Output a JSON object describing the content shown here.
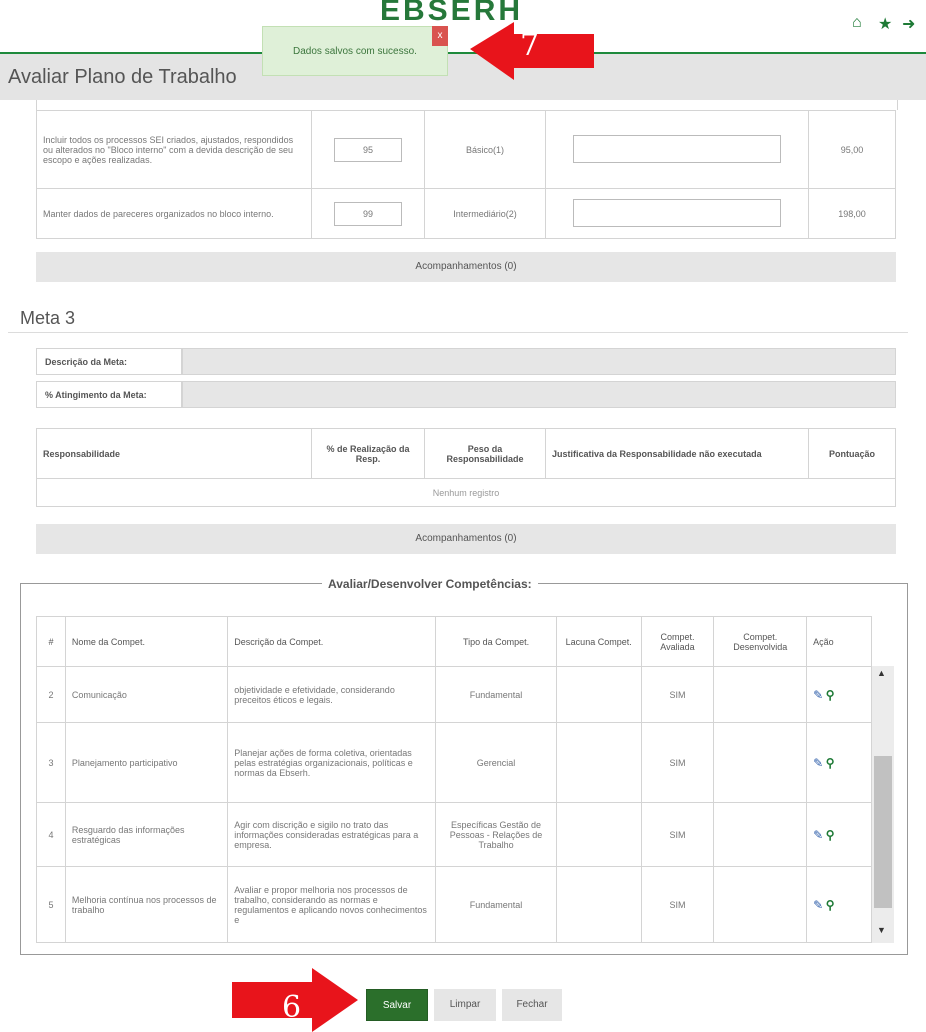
{
  "header": {
    "logo_text": "EBSERH"
  },
  "toast": {
    "message": "Dados salvos com sucesso.",
    "close": "x"
  },
  "title": "Avaliar Plano de Trabalho",
  "steps": {
    "toast_step": "7",
    "save_step": "6"
  },
  "upper_table": {
    "rows": [
      {
        "desc": "Incluir todos os processos SEI criados, ajustados, respondidos ou alterados no \"Bloco interno\" com a devida descrição de seu escopo e ações realizadas.",
        "value": "95",
        "peso": "Básico(1)",
        "pont": "95,00"
      },
      {
        "desc": "Manter dados de pareceres organizados no bloco interno.",
        "value": "99",
        "peso": "Intermediário(2)",
        "pont": "198,00"
      }
    ]
  },
  "acompanhamentos": "Acompanhamentos (0)",
  "meta3": {
    "title": "Meta 3",
    "desc_label": "Descrição da Meta:",
    "ating_label": "% Atingimento da Meta:",
    "headers": [
      "Responsabilidade",
      "% de Realização da Resp.",
      "Peso da Responsabilidade",
      "Justificativa da Responsabilidade não executada",
      "Pontuação"
    ],
    "empty": "Nenhum registro"
  },
  "competencias": {
    "legend": "Avaliar/Desenvolver Competências:",
    "headers": [
      "#",
      "Nome da Compet.",
      "Descrição da Compet.",
      "Tipo da Compet.",
      "Lacuna Compet.",
      "Compet. Avaliada",
      "Compet. Desenvolvida",
      "Ação"
    ],
    "rows": [
      {
        "n": "2",
        "nome": "Comunicação",
        "desc": "objetividade e efetividade, considerando preceitos éticos e legais.",
        "tipo": "Fundamental",
        "lacuna": "",
        "avaliada": "SIM",
        "desenv": ""
      },
      {
        "n": "3",
        "nome": "Planejamento participativo",
        "desc": "Planejar ações de forma coletiva, orientadas pelas estratégias organizacionais, políticas e normas da Ebserh.",
        "tipo": "Gerencial",
        "lacuna": "",
        "avaliada": "SIM",
        "desenv": ""
      },
      {
        "n": "4",
        "nome": "Resguardo das informações estratégicas",
        "desc": "Agir com discrição e sigilo no trato das informações consideradas estratégicas para a empresa.",
        "tipo": "Específicas Gestão de Pessoas - Relações de Trabalho",
        "lacuna": "",
        "avaliada": "SIM",
        "desenv": ""
      },
      {
        "n": "5",
        "nome": "Melhoria contínua nos processos de trabalho",
        "desc": "Avaliar e propor melhoria nos processos de trabalho, considerando as normas e regulamentos e aplicando novos conhecimentos e",
        "tipo": "Fundamental",
        "lacuna": "",
        "avaliada": "SIM",
        "desenv": ""
      }
    ]
  },
  "buttons": {
    "save": "Salvar",
    "clear": "Limpar",
    "close": "Fechar"
  },
  "colors": {
    "brand_green": "#1e7a36",
    "save_button": "#2b6f2b",
    "arrow_red": "#e8141b",
    "toast_bg": "#dff0d8"
  }
}
